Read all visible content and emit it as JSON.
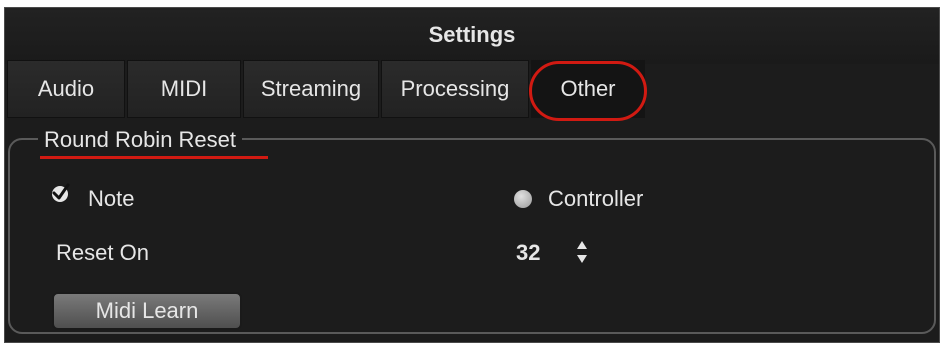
{
  "window": {
    "title": "Settings"
  },
  "tabs": [
    {
      "label": "Audio"
    },
    {
      "label": "MIDI"
    },
    {
      "label": "Streaming"
    },
    {
      "label": "Processing"
    },
    {
      "label": "Other"
    }
  ],
  "active_tab": "Other",
  "highlight_color": "#d11a12",
  "group": {
    "title": "Round Robin Reset",
    "note_option": {
      "label": "Note",
      "checked": true,
      "icon": "checkmark-icon"
    },
    "controller_option": {
      "label": "Controller",
      "checked": false,
      "icon": "radio-icon"
    },
    "reset_on": {
      "label": "Reset On",
      "value": "32",
      "icon": "stepper-icon"
    },
    "midi_learn_label": "Midi Learn"
  }
}
